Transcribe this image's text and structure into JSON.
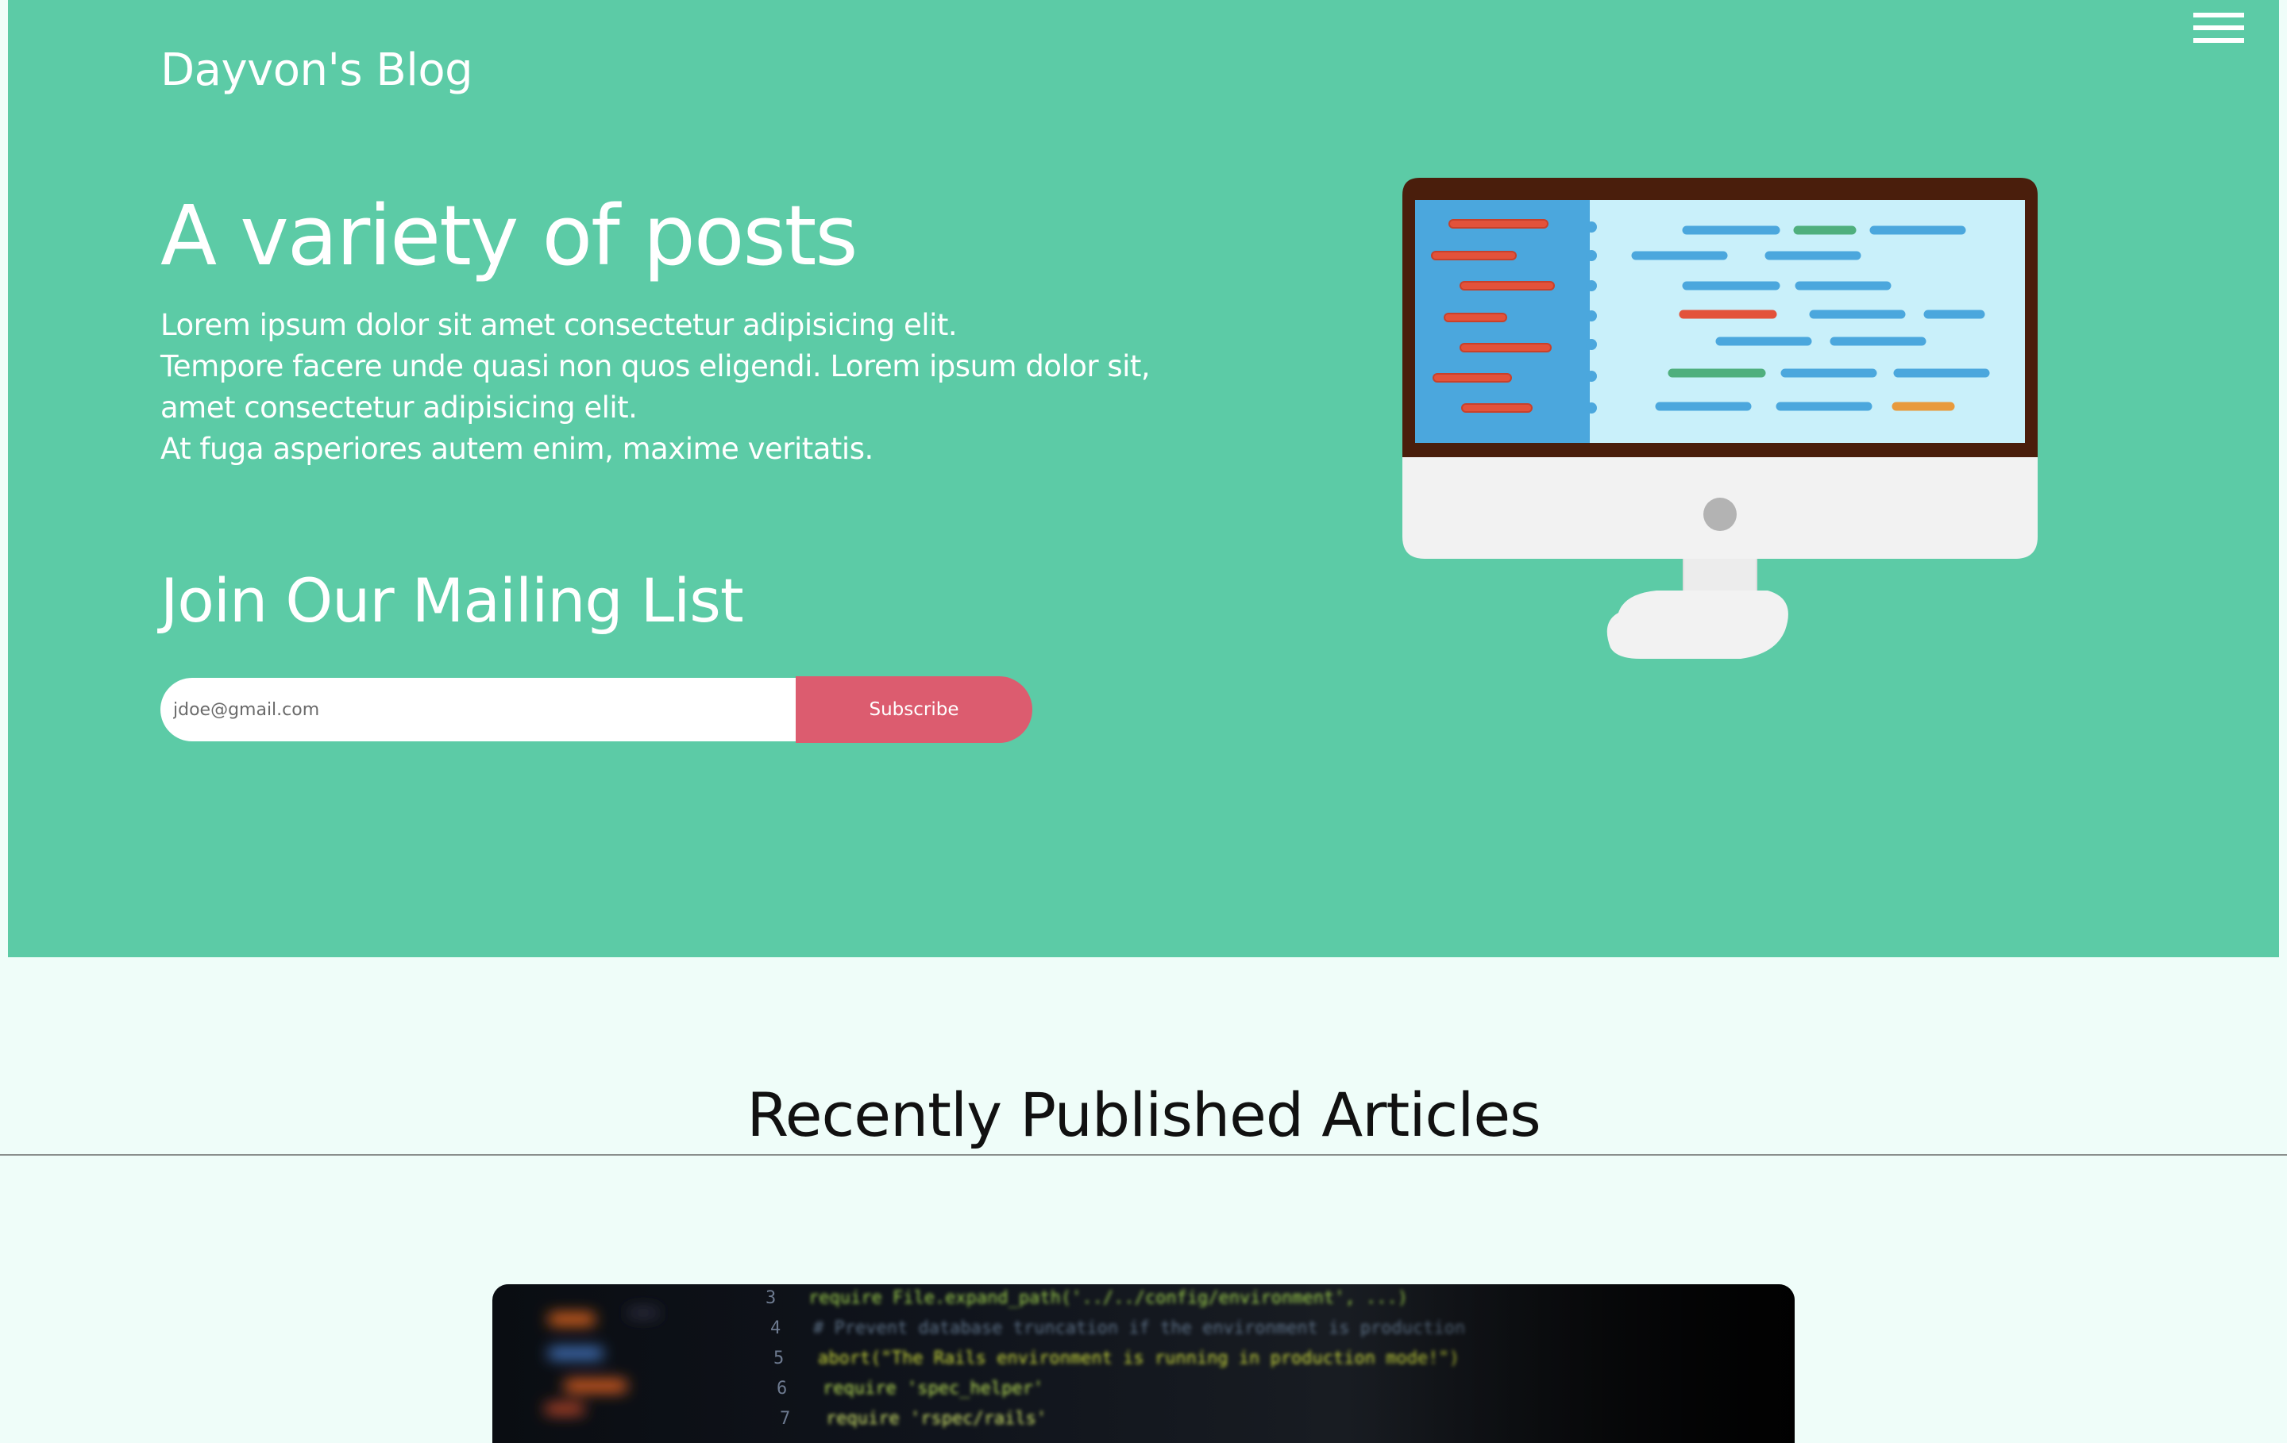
{
  "header": {
    "blog_title": "Dayvon's Blog",
    "menu_icon": "hamburger-menu-icon"
  },
  "hero": {
    "headline": "A variety of posts",
    "paragraph_lines": [
      "Lorem ipsum dolor sit amet consectetur adipisicing elit.",
      "Tempore facere unde quasi non quos eligendi. Lorem ipsum dolor sit,",
      "amet consectetur adipisicing elit.",
      "At fuga asperiores autem enim, maxime veritatis."
    ],
    "illustration": "computer-monitor-code-illustration"
  },
  "mailing": {
    "title": "Join Our Mailing List",
    "email_placeholder": "jdoe@gmail.com",
    "subscribe_label": "Subscribe"
  },
  "articles": {
    "section_title": "Recently Published Articles",
    "featured_image": {
      "code_lines": [
        {
          "num": "3",
          "text": "require File.expand_path('../../config/environment', ...)"
        },
        {
          "num": "4",
          "text": "# Prevent database truncation if the environment is production"
        },
        {
          "num": "5",
          "text": "abort(\"The Rails environment is running in production mode!\")"
        },
        {
          "num": "6",
          "text": "require 'spec_helper'"
        },
        {
          "num": "7",
          "text": "require 'rspec/rails'"
        }
      ]
    }
  },
  "colors": {
    "hero_background": "#5ccba6",
    "page_background": "#effdf9",
    "subscribe_button": "#dc5c6f",
    "text_on_hero": "#ffffff"
  }
}
